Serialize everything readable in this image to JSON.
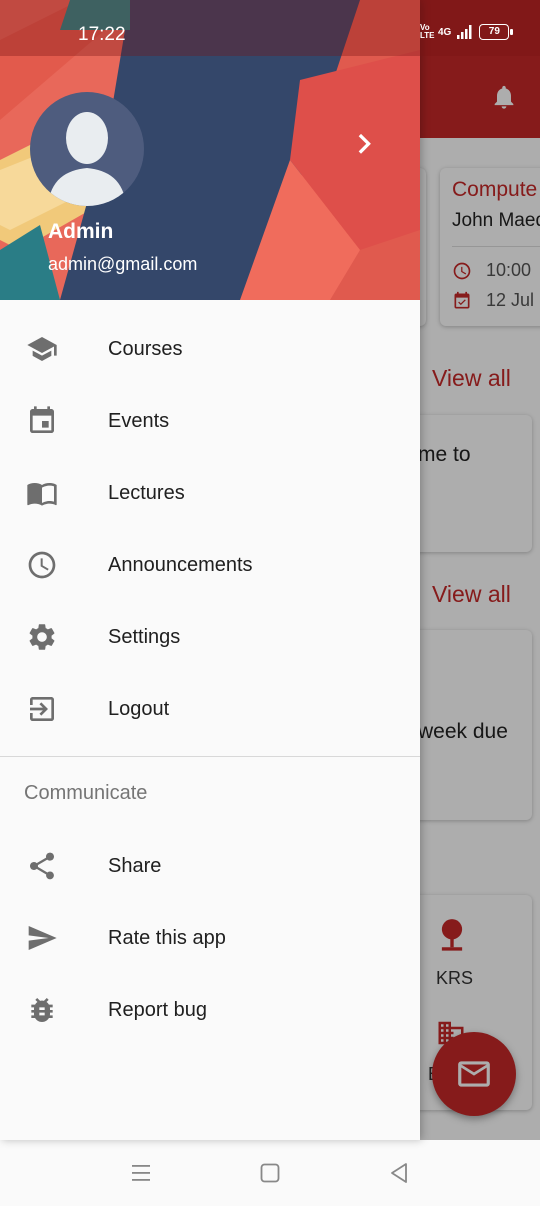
{
  "status_bar": {
    "time": "17:22",
    "network": "4G",
    "volte": "Vo LTE",
    "battery": "79"
  },
  "background": {
    "course_card": {
      "title": "Compute",
      "teacher": "John Maed",
      "time": "10:00",
      "date": "12 Jul"
    },
    "view_all_1": "View all",
    "card2_text": "me to",
    "view_all_2": "View all",
    "card3_text": "week due",
    "menu_krs_label": "KRS",
    "menu_partial_label": "E",
    "accent_color": "#c62828"
  },
  "drawer": {
    "header": {
      "name": "Admin",
      "email": "admin@gmail.com"
    },
    "items": [
      {
        "label": "Courses",
        "icon": "school-icon"
      },
      {
        "label": "Events",
        "icon": "event-icon"
      },
      {
        "label": "Lectures",
        "icon": "book-icon"
      },
      {
        "label": "Announcements",
        "icon": "clock-icon"
      },
      {
        "label": "Settings",
        "icon": "gear-icon"
      },
      {
        "label": "Logout",
        "icon": "logout-icon"
      }
    ],
    "section_title": "Communicate",
    "communicate_items": [
      {
        "label": "Share",
        "icon": "share-icon"
      },
      {
        "label": "Rate this app",
        "icon": "send-icon"
      },
      {
        "label": "Report bug",
        "icon": "bug-icon"
      }
    ]
  },
  "system_nav": {
    "buttons": [
      "menu-icon",
      "home-icon",
      "back-icon"
    ]
  }
}
